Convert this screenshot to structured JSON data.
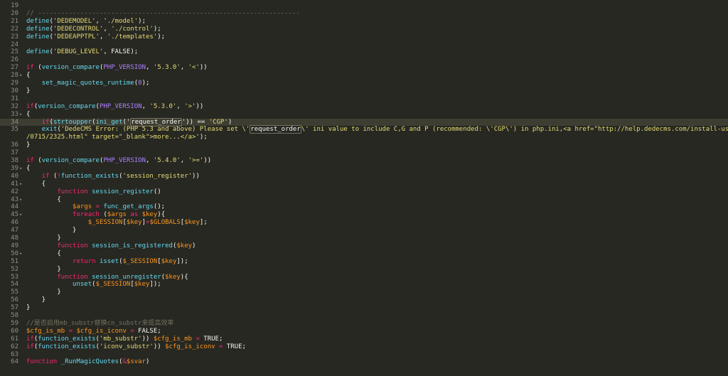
{
  "editor": {
    "lines": [
      {
        "n": "19",
        "fold": "",
        "tokens": [
          [
            "pl",
            ""
          ]
        ]
      },
      {
        "n": "20",
        "fold": "",
        "tokens": [
          [
            "cm",
            "// --------------------------------------------------------------------"
          ]
        ]
      },
      {
        "n": "21",
        "fold": "",
        "tokens": [
          [
            "fn",
            "define"
          ],
          [
            "pl",
            "("
          ],
          [
            "st",
            "'DEDEMODEL'"
          ],
          [
            "pl",
            ", "
          ],
          [
            "st",
            "'./model'"
          ],
          [
            "pl",
            ");"
          ]
        ]
      },
      {
        "n": "22",
        "fold": "",
        "tokens": [
          [
            "fn",
            "define"
          ],
          [
            "pl",
            "("
          ],
          [
            "st",
            "'DEDECONTROL'"
          ],
          [
            "pl",
            ", "
          ],
          [
            "st",
            "'./control'"
          ],
          [
            "pl",
            ");"
          ]
        ]
      },
      {
        "n": "23",
        "fold": "",
        "tokens": [
          [
            "fn",
            "define"
          ],
          [
            "pl",
            "("
          ],
          [
            "st",
            "'DEDEAPPTPL'"
          ],
          [
            "pl",
            ", "
          ],
          [
            "st",
            "'./templates'"
          ],
          [
            "pl",
            ");"
          ]
        ]
      },
      {
        "n": "24",
        "fold": "",
        "tokens": [
          [
            "pl",
            ""
          ]
        ]
      },
      {
        "n": "25",
        "fold": "",
        "tokens": [
          [
            "fn",
            "define"
          ],
          [
            "pl",
            "("
          ],
          [
            "st",
            "'DEBUG_LEVEL'"
          ],
          [
            "pl",
            ", FALSE);"
          ]
        ]
      },
      {
        "n": "26",
        "fold": "",
        "tokens": [
          [
            "pl",
            ""
          ]
        ]
      },
      {
        "n": "27",
        "fold": "",
        "tokens": [
          [
            "kw",
            "if"
          ],
          [
            "pl",
            " ("
          ],
          [
            "fn",
            "version_compare"
          ],
          [
            "pl",
            "("
          ],
          [
            "cn",
            "PHP_VERSION"
          ],
          [
            "pl",
            ", "
          ],
          [
            "st",
            "'5.3.0'"
          ],
          [
            "pl",
            ", "
          ],
          [
            "st",
            "'<'"
          ],
          [
            "pl",
            "))"
          ]
        ]
      },
      {
        "n": "28",
        "fold": "▾",
        "tokens": [
          [
            "pl",
            "{"
          ]
        ]
      },
      {
        "n": "29",
        "fold": "",
        "tokens": [
          [
            "pl",
            "    "
          ],
          [
            "fn",
            "set_magic_quotes_runtime"
          ],
          [
            "pl",
            "("
          ],
          [
            "cn",
            "0"
          ],
          [
            "pl",
            ");"
          ]
        ]
      },
      {
        "n": "30",
        "fold": "",
        "tokens": [
          [
            "pl",
            "}"
          ]
        ]
      },
      {
        "n": "31",
        "fold": "",
        "tokens": [
          [
            "pl",
            ""
          ]
        ]
      },
      {
        "n": "32",
        "fold": "",
        "tokens": [
          [
            "kw",
            "if"
          ],
          [
            "pl",
            "("
          ],
          [
            "fn",
            "version_compare"
          ],
          [
            "pl",
            "("
          ],
          [
            "cn",
            "PHP_VERSION"
          ],
          [
            "pl",
            ", "
          ],
          [
            "st",
            "'5.3.0'"
          ],
          [
            "pl",
            ", "
          ],
          [
            "st",
            "'>'"
          ],
          [
            "pl",
            "))"
          ]
        ]
      },
      {
        "n": "33",
        "fold": "▾",
        "tokens": [
          [
            "pl",
            "{"
          ]
        ]
      },
      {
        "n": "34",
        "fold": "",
        "cur": true,
        "tokens": [
          [
            "pl",
            "    "
          ],
          [
            "kw",
            "if"
          ],
          [
            "pl",
            "("
          ],
          [
            "fn",
            "strtoupper"
          ],
          [
            "pl",
            "("
          ],
          [
            "fn",
            "ini_get"
          ],
          [
            "pl",
            "('"
          ],
          [
            "hl",
            "request_order"
          ],
          [
            "pl",
            "')) == "
          ],
          [
            "st",
            "'CGP'"
          ],
          [
            "pl",
            ")"
          ]
        ]
      },
      {
        "n": "35",
        "fold": "",
        "tokens": [
          [
            "pl",
            "    "
          ],
          [
            "fn",
            "exit"
          ],
          [
            "pl",
            "("
          ],
          [
            "st",
            "'DedeCMS Error: (PHP 5.3 and above) Please set \\'"
          ],
          [
            "hl",
            "request_order"
          ],
          [
            "st",
            "\\' ini value to include C,G and P (recommended: \\'CGP\\') in php.ini,<a href=\"http://help.dedecms.com/install-use/apply/2011"
          ]
        ]
      },
      {
        "n": "",
        "fold": "",
        "tokens": [
          [
            "st",
            "/0715/2325.html\" target=\"_blank\">more...</a>'"
          ],
          [
            "pl",
            ");"
          ]
        ]
      },
      {
        "n": "36",
        "fold": "",
        "tokens": [
          [
            "pl",
            "}"
          ]
        ]
      },
      {
        "n": "37",
        "fold": "",
        "tokens": [
          [
            "pl",
            ""
          ]
        ]
      },
      {
        "n": "38",
        "fold": "",
        "tokens": [
          [
            "kw",
            "if"
          ],
          [
            "pl",
            " ("
          ],
          [
            "fn",
            "version_compare"
          ],
          [
            "pl",
            "("
          ],
          [
            "cn",
            "PHP_VERSION"
          ],
          [
            "pl",
            ", "
          ],
          [
            "st",
            "'5.4.0'"
          ],
          [
            "pl",
            ", "
          ],
          [
            "st",
            "'>='"
          ],
          [
            "pl",
            "))"
          ]
        ]
      },
      {
        "n": "39",
        "fold": "▾",
        "tokens": [
          [
            "pl",
            "{"
          ]
        ]
      },
      {
        "n": "40",
        "fold": "",
        "tokens": [
          [
            "pl",
            "    "
          ],
          [
            "kw",
            "if"
          ],
          [
            "pl",
            " ("
          ],
          [
            "kw",
            "!"
          ],
          [
            "fn",
            "function_exists"
          ],
          [
            "pl",
            "("
          ],
          [
            "st",
            "'session_register'"
          ],
          [
            "pl",
            "))"
          ]
        ]
      },
      {
        "n": "41",
        "fold": "▾",
        "tokens": [
          [
            "pl",
            "    {"
          ]
        ]
      },
      {
        "n": "42",
        "fold": "",
        "tokens": [
          [
            "pl",
            "        "
          ],
          [
            "kw",
            "function"
          ],
          [
            "pl",
            " "
          ],
          [
            "fn",
            "session_register"
          ],
          [
            "pl",
            "()"
          ]
        ]
      },
      {
        "n": "43",
        "fold": "▾",
        "tokens": [
          [
            "pl",
            "        {"
          ]
        ]
      },
      {
        "n": "44",
        "fold": "",
        "tokens": [
          [
            "pl",
            "            "
          ],
          [
            "vr",
            "$args"
          ],
          [
            "pl",
            " "
          ],
          [
            "kw",
            "="
          ],
          [
            "pl",
            " "
          ],
          [
            "fn",
            "func_get_args"
          ],
          [
            "pl",
            "();"
          ]
        ]
      },
      {
        "n": "45",
        "fold": "▾",
        "tokens": [
          [
            "pl",
            "            "
          ],
          [
            "kw",
            "foreach"
          ],
          [
            "pl",
            " ("
          ],
          [
            "vr",
            "$args"
          ],
          [
            "pl",
            " "
          ],
          [
            "kw",
            "as"
          ],
          [
            "pl",
            " "
          ],
          [
            "vr",
            "$key"
          ],
          [
            "pl",
            "){"
          ]
        ]
      },
      {
        "n": "46",
        "fold": "",
        "tokens": [
          [
            "pl",
            "                "
          ],
          [
            "vr",
            "$_SESSION"
          ],
          [
            "pl",
            "["
          ],
          [
            "vr",
            "$key"
          ],
          [
            "pl",
            "]"
          ],
          [
            "kw",
            "="
          ],
          [
            "vr",
            "$GLOBALS"
          ],
          [
            "pl",
            "["
          ],
          [
            "vr",
            "$key"
          ],
          [
            "pl",
            "];"
          ]
        ]
      },
      {
        "n": "47",
        "fold": "",
        "tokens": [
          [
            "pl",
            "            }"
          ]
        ]
      },
      {
        "n": "48",
        "fold": "",
        "tokens": [
          [
            "pl",
            "        }"
          ]
        ]
      },
      {
        "n": "49",
        "fold": "",
        "tokens": [
          [
            "pl",
            "        "
          ],
          [
            "kw",
            "function"
          ],
          [
            "pl",
            " "
          ],
          [
            "fn",
            "session_is_registered"
          ],
          [
            "pl",
            "("
          ],
          [
            "vr",
            "$key"
          ],
          [
            "pl",
            ")"
          ]
        ]
      },
      {
        "n": "50",
        "fold": "▾",
        "tokens": [
          [
            "pl",
            "        {"
          ]
        ]
      },
      {
        "n": "51",
        "fold": "",
        "tokens": [
          [
            "pl",
            "            "
          ],
          [
            "kw",
            "return"
          ],
          [
            "pl",
            " "
          ],
          [
            "fn",
            "isset"
          ],
          [
            "pl",
            "("
          ],
          [
            "vr",
            "$_SESSION"
          ],
          [
            "pl",
            "["
          ],
          [
            "vr",
            "$key"
          ],
          [
            "pl",
            "]);"
          ]
        ]
      },
      {
        "n": "52",
        "fold": "",
        "tokens": [
          [
            "pl",
            "        }"
          ]
        ]
      },
      {
        "n": "53",
        "fold": "",
        "tokens": [
          [
            "pl",
            "        "
          ],
          [
            "kw",
            "function"
          ],
          [
            "pl",
            " "
          ],
          [
            "fn",
            "session_unregister"
          ],
          [
            "pl",
            "("
          ],
          [
            "vr",
            "$key"
          ],
          [
            "pl",
            "){"
          ]
        ]
      },
      {
        "n": "54",
        "fold": "",
        "tokens": [
          [
            "pl",
            "            "
          ],
          [
            "fn",
            "unset"
          ],
          [
            "pl",
            "("
          ],
          [
            "vr",
            "$_SESSION"
          ],
          [
            "pl",
            "["
          ],
          [
            "vr",
            "$key"
          ],
          [
            "pl",
            "]);"
          ]
        ]
      },
      {
        "n": "55",
        "fold": "",
        "tokens": [
          [
            "pl",
            "        }"
          ]
        ]
      },
      {
        "n": "56",
        "fold": "",
        "tokens": [
          [
            "pl",
            "    }"
          ]
        ]
      },
      {
        "n": "57",
        "fold": "",
        "tokens": [
          [
            "pl",
            "}"
          ]
        ]
      },
      {
        "n": "58",
        "fold": "",
        "tokens": [
          [
            "pl",
            ""
          ]
        ]
      },
      {
        "n": "59",
        "fold": "",
        "tokens": [
          [
            "cm",
            "//是否启用mb_substr替换cn_substr来提高效率"
          ]
        ]
      },
      {
        "n": "60",
        "fold": "",
        "tokens": [
          [
            "vr",
            "$cfg_is_mb"
          ],
          [
            "pl",
            " "
          ],
          [
            "kw",
            "="
          ],
          [
            "pl",
            " "
          ],
          [
            "vr",
            "$cfg_is_iconv"
          ],
          [
            "pl",
            " "
          ],
          [
            "kw",
            "="
          ],
          [
            "pl",
            " FALSE;"
          ]
        ]
      },
      {
        "n": "61",
        "fold": "",
        "tokens": [
          [
            "kw",
            "if"
          ],
          [
            "pl",
            "("
          ],
          [
            "fn",
            "function_exists"
          ],
          [
            "pl",
            "("
          ],
          [
            "st",
            "'mb_substr'"
          ],
          [
            "pl",
            ")) "
          ],
          [
            "vr",
            "$cfg_is_mb"
          ],
          [
            "pl",
            " "
          ],
          [
            "kw",
            "="
          ],
          [
            "pl",
            " TRUE;"
          ]
        ]
      },
      {
        "n": "62",
        "fold": "",
        "tokens": [
          [
            "kw",
            "if"
          ],
          [
            "pl",
            "("
          ],
          [
            "fn",
            "function_exists"
          ],
          [
            "pl",
            "("
          ],
          [
            "st",
            "'iconv_substr'"
          ],
          [
            "pl",
            ")) "
          ],
          [
            "vr",
            "$cfg_is_iconv"
          ],
          [
            "pl",
            " "
          ],
          [
            "kw",
            "="
          ],
          [
            "pl",
            " TRUE;"
          ]
        ]
      },
      {
        "n": "63",
        "fold": "",
        "tokens": [
          [
            "pl",
            ""
          ]
        ]
      },
      {
        "n": "64",
        "fold": "",
        "tokens": [
          [
            "kw",
            "function"
          ],
          [
            "pl",
            " "
          ],
          [
            "fn",
            "_RunMagicQuotes"
          ],
          [
            "pl",
            "("
          ],
          [
            "kw",
            "&"
          ],
          [
            "vr",
            "$svar"
          ],
          [
            "pl",
            ")"
          ]
        ]
      }
    ]
  }
}
